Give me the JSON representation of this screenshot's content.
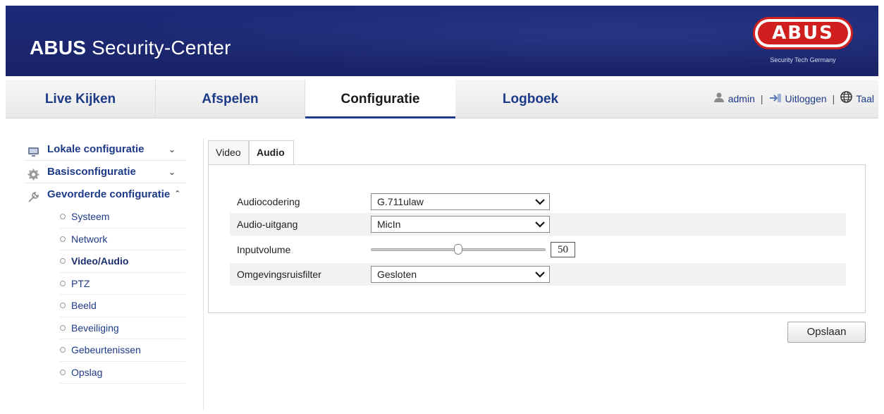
{
  "header": {
    "brand": "ABUS",
    "title_rest": " Security-Center",
    "logo_text": "ABUS",
    "logo_tagline": "Security Tech Germany"
  },
  "nav": {
    "tabs": [
      {
        "label": "Live Kijken",
        "active": false
      },
      {
        "label": "Afspelen",
        "active": false
      },
      {
        "label": "Configuratie",
        "active": true
      },
      {
        "label": "Logboek",
        "active": false
      }
    ],
    "user": "admin",
    "logout": "Uitloggen",
    "language": "Taal"
  },
  "sidebar": {
    "groups": [
      {
        "label": "Lokale configuratie",
        "icon": "monitor-icon",
        "expanded": false
      },
      {
        "label": "Basisconfiguratie",
        "icon": "gear-icon",
        "expanded": false
      },
      {
        "label": "Gevorderde configuratie",
        "icon": "wrench-icon",
        "expanded": true
      }
    ],
    "items": [
      {
        "label": "Systeem"
      },
      {
        "label": "Network"
      },
      {
        "label": "Video/Audio",
        "active": true
      },
      {
        "label": "PTZ"
      },
      {
        "label": "Beeld"
      },
      {
        "label": "Beveiliging"
      },
      {
        "label": "Gebeurtenissen"
      },
      {
        "label": "Opslag"
      }
    ]
  },
  "content": {
    "tabs": [
      {
        "label": "Video",
        "active": false
      },
      {
        "label": "Audio",
        "active": true
      }
    ],
    "fields": {
      "audio_encoding": {
        "label": "Audiocodering",
        "value": "G.711ulaw"
      },
      "audio_output": {
        "label": "Audio-uitgang",
        "value": "MicIn"
      },
      "input_volume": {
        "label": "Inputvolume",
        "value": "50",
        "level": 0.5
      },
      "noise_filter": {
        "label": "Omgevingsruisfilter",
        "value": "Gesloten"
      }
    },
    "save_label": "Opslaan"
  },
  "colors": {
    "header_bg": "#1b2771",
    "nav_text": "#1d3a86",
    "logo_red": "#cf1f1f"
  }
}
